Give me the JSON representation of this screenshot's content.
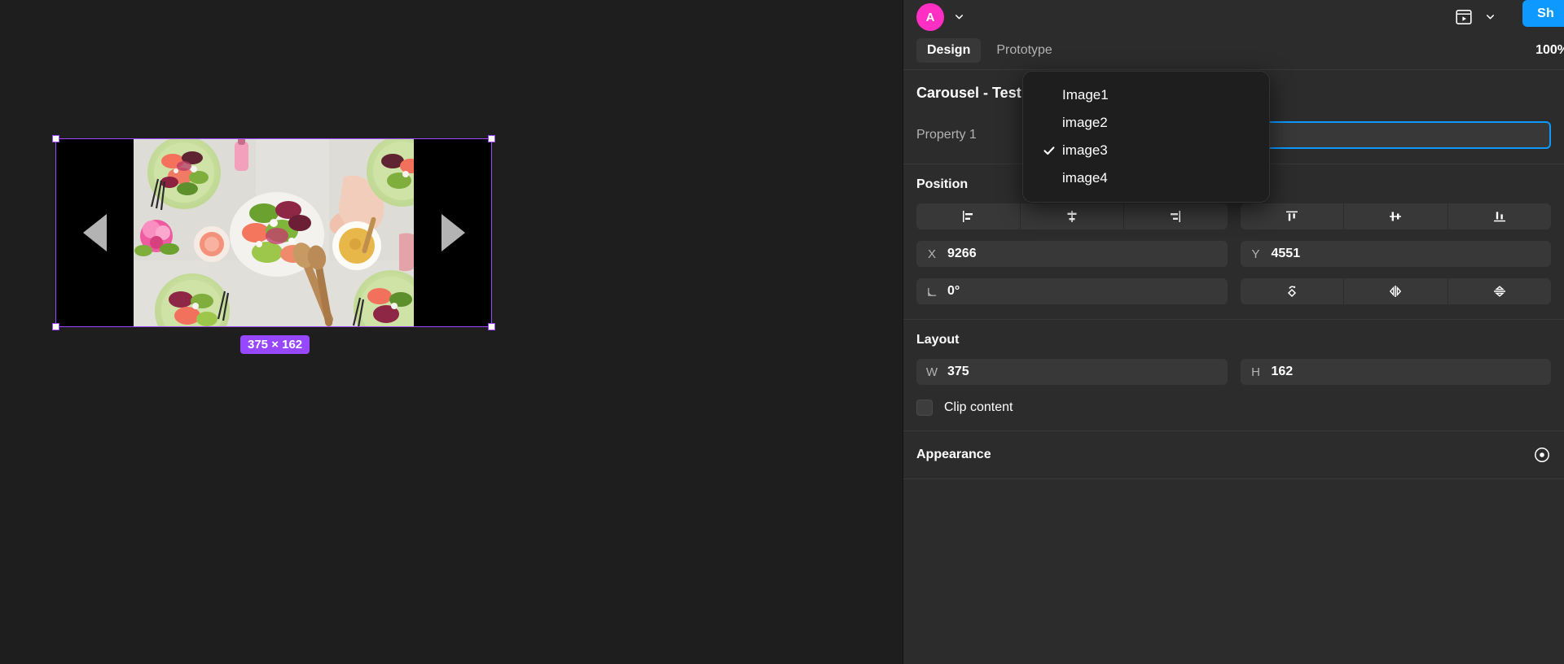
{
  "canvas": {
    "selection": {
      "size_badge": "375 × 162",
      "frame_name": "Carousel - Test"
    },
    "carousel": {
      "prev_arrow": "prev-arrow",
      "next_arrow": "next-arrow",
      "image_alt": "salad-plates-photo"
    }
  },
  "topbar": {
    "avatar_initial": "A",
    "avatar_color": "#ff2fc4",
    "present_icon": "present-play-icon",
    "present_chevron": "chevron-down-icon",
    "share_label": "Sh",
    "share_color": "#0d99ff"
  },
  "tabs": {
    "design": "Design",
    "prototype": "Prototype",
    "zoom_level": "100%"
  },
  "component": {
    "title": "Carousel - Test",
    "title_chevron": "chevron-down-icon",
    "property_label": "Property 1",
    "property_value": "image3",
    "focus_color": "#0d99ff"
  },
  "position": {
    "title": "Position",
    "align_buttons": [
      "align-left-icon",
      "align-horizontal-center-icon",
      "align-right-icon",
      "align-top-icon",
      "align-vertical-center-icon",
      "align-bottom-icon"
    ],
    "x_label": "X",
    "x_value": "9266",
    "y_label": "Y",
    "y_value": "4551",
    "rotation_label": "angle-icon",
    "rotation_value": "0°",
    "transform_buttons": [
      "corner-radius-rotate-icon",
      "flip-horizontal-icon",
      "flip-vertical-icon"
    ]
  },
  "layout": {
    "title": "Layout",
    "w_label": "W",
    "w_value": "375",
    "h_label": "H",
    "h_value": "162",
    "clip_content_label": "Clip content",
    "clip_content_checked": false
  },
  "appearance": {
    "title": "Appearance",
    "visibility_icon": "eye-icon"
  },
  "dropdown": {
    "items": [
      {
        "label": "Image1",
        "checked": false
      },
      {
        "label": "image2",
        "checked": false
      },
      {
        "label": "image3",
        "checked": true
      },
      {
        "label": "image4",
        "checked": false
      }
    ]
  }
}
